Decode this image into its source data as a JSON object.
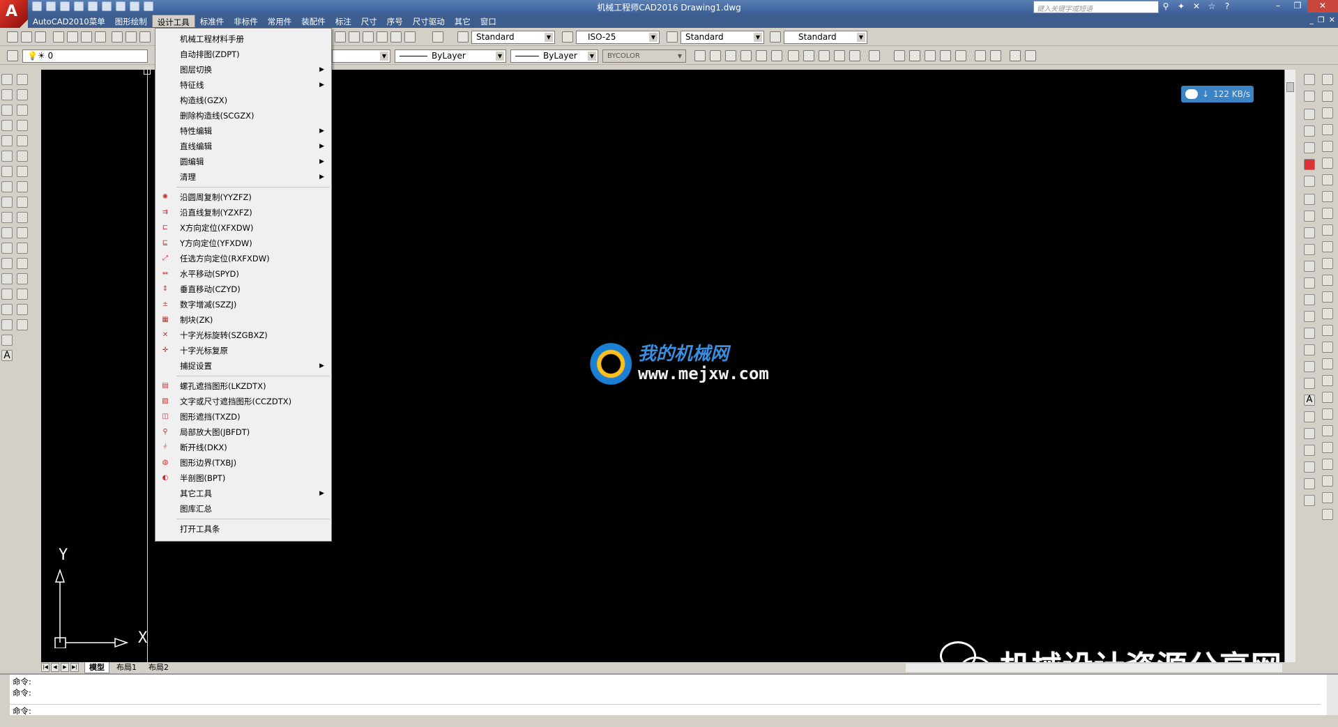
{
  "window": {
    "title": "机械工程师CAD2016      Drawing1.dwg",
    "search_placeholder": "键入关键字或短语"
  },
  "menubar": {
    "items": [
      "AutoCAD2010菜单",
      "图形绘制",
      "设计工具",
      "标准件",
      "非标件",
      "常用件",
      "装配件",
      "标注",
      "尺寸",
      "序号",
      "尺寸驱动",
      "其它",
      "窗口"
    ],
    "active_index": 2
  },
  "toolbar": {
    "text_style": "Standard",
    "dim_style": "ISO-25",
    "table_style": "Standard",
    "multileader_style": "Standard",
    "layer": "0",
    "linetype": "ByLayer",
    "lineweight": "ByLayer",
    "plot_color": "BYCOLOR"
  },
  "dropdown": {
    "items": [
      {
        "label": "机械工程材料手册",
        "submenu": false,
        "icon": ""
      },
      {
        "label": "自动排图(ZDPT)",
        "submenu": false,
        "icon": ""
      },
      {
        "label": "图层切换",
        "submenu": true,
        "icon": ""
      },
      {
        "label": "特征线",
        "submenu": true,
        "icon": ""
      },
      {
        "label": "构造线(GZX)",
        "submenu": false,
        "icon": ""
      },
      {
        "label": "删除构造线(SCGZX)",
        "submenu": false,
        "icon": ""
      },
      {
        "label": "特性编辑",
        "submenu": true,
        "icon": ""
      },
      {
        "label": "直线编辑",
        "submenu": true,
        "icon": ""
      },
      {
        "label": "圆编辑",
        "submenu": true,
        "icon": ""
      },
      {
        "label": "清理",
        "submenu": true,
        "icon": ""
      },
      {
        "sep": true
      },
      {
        "label": "沿圆周复制(YYZFZ)",
        "submenu": false,
        "icon": "circle-copy-icon"
      },
      {
        "label": "沿直线复制(YZXFZ)",
        "submenu": false,
        "icon": "line-copy-icon"
      },
      {
        "label": "X方向定位(XFXDW)",
        "submenu": false,
        "icon": "x-locate-icon"
      },
      {
        "label": "Y方向定位(YFXDW)",
        "submenu": false,
        "icon": "y-locate-icon"
      },
      {
        "label": "任选方向定位(RXFXDW)",
        "submenu": false,
        "icon": "any-locate-icon"
      },
      {
        "label": "水平移动(SPYD)",
        "submenu": false,
        "icon": "hmove-icon"
      },
      {
        "label": "垂直移动(CZYD)",
        "submenu": false,
        "icon": "vmove-icon"
      },
      {
        "label": "数字增减(SZZJ)",
        "submenu": false,
        "icon": "number-icon"
      },
      {
        "label": "制块(ZK)",
        "submenu": false,
        "icon": "block-icon"
      },
      {
        "label": "十字光标旋转(SZGBXZ)",
        "submenu": false,
        "icon": "cursor-rotate-icon"
      },
      {
        "label": "十字光标复原",
        "submenu": false,
        "icon": "cursor-reset-icon"
      },
      {
        "label": "捕捉设置",
        "submenu": true,
        "icon": ""
      },
      {
        "sep": true
      },
      {
        "label": "螺孔遮挡图形(LKZDTX)",
        "submenu": false,
        "icon": "bolt-hide-icon"
      },
      {
        "label": "文字或尺寸遮挡图形(CCZDTX)",
        "submenu": false,
        "icon": "text-hide-icon"
      },
      {
        "label": "图形遮挡(TXZD)",
        "submenu": false,
        "icon": "shape-hide-icon"
      },
      {
        "label": "局部放大图(JBFDT)",
        "submenu": false,
        "icon": "zoom-detail-icon"
      },
      {
        "label": "断开线(DKX)",
        "submenu": false,
        "icon": "break-line-icon"
      },
      {
        "label": "图形边界(TXBJ)",
        "submenu": false,
        "icon": "boundary-icon"
      },
      {
        "label": "半剖图(BPT)",
        "submenu": false,
        "icon": "half-section-icon"
      },
      {
        "label": "其它工具",
        "submenu": true,
        "icon": ""
      },
      {
        "label": "图库汇总",
        "submenu": false,
        "icon": ""
      },
      {
        "sep": true
      },
      {
        "label": "打开工具条",
        "submenu": false,
        "icon": ""
      }
    ]
  },
  "canvas": {
    "ucs_y": "Y",
    "ucs_x": "X",
    "net_speed": "122 KB/s",
    "watermark_cn": "我的机械网",
    "watermark_url": "www.mejxw.com",
    "wechat_watermark": "机械设计资源分享网"
  },
  "layout_tabs": [
    "模型",
    "布局1",
    "布局2"
  ],
  "command": {
    "line1": "命令:",
    "line2": "命令:",
    "prompt": "命令:"
  },
  "colors": {
    "title_bg": "#3d5d8f",
    "canvas_bg": "#000000",
    "menu_bg": "#f0f0f0",
    "net_widget": "#3a84c6"
  }
}
